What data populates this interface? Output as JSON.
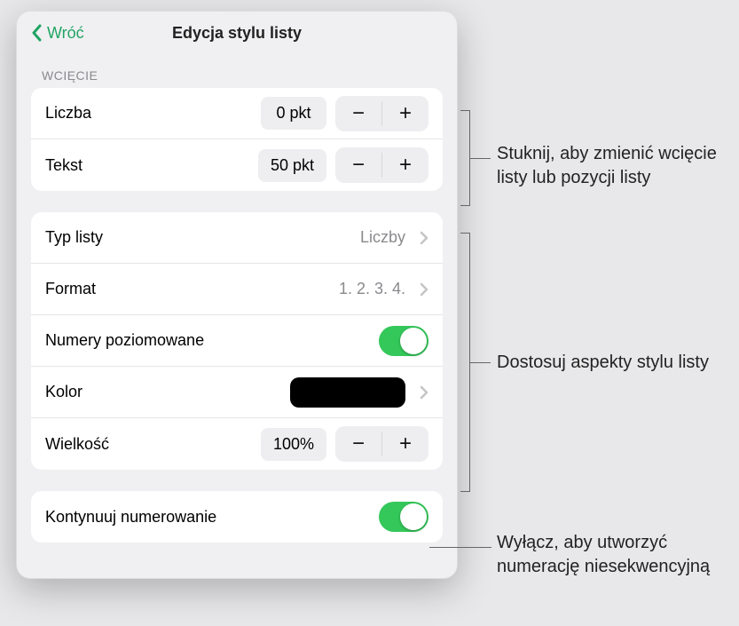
{
  "header": {
    "back_label": "Wróć",
    "title": "Edycja stylu listy"
  },
  "sections": {
    "indent_label": "WCIĘCIE",
    "number": {
      "label": "Liczba",
      "value": "0 pkt"
    },
    "text": {
      "label": "Tekst",
      "value": "50 pkt"
    },
    "list_type": {
      "label": "Typ listy",
      "value": "Liczby"
    },
    "format": {
      "label": "Format",
      "value": "1. 2. 3. 4."
    },
    "tiered": {
      "label": "Numery poziomowane",
      "on": true
    },
    "color": {
      "label": "Kolor",
      "swatch": "#000000"
    },
    "size": {
      "label": "Wielkość",
      "value": "100%"
    },
    "continue": {
      "label": "Kontynuuj numerowanie",
      "on": true
    }
  },
  "callouts": {
    "indent": "Stuknij, aby zmienić wcięcie listy lub pozycji listy",
    "style": "Dostosuj aspekty stylu listy",
    "continue": "Wyłącz, aby utworzyć numerację niesekwencyjną"
  }
}
